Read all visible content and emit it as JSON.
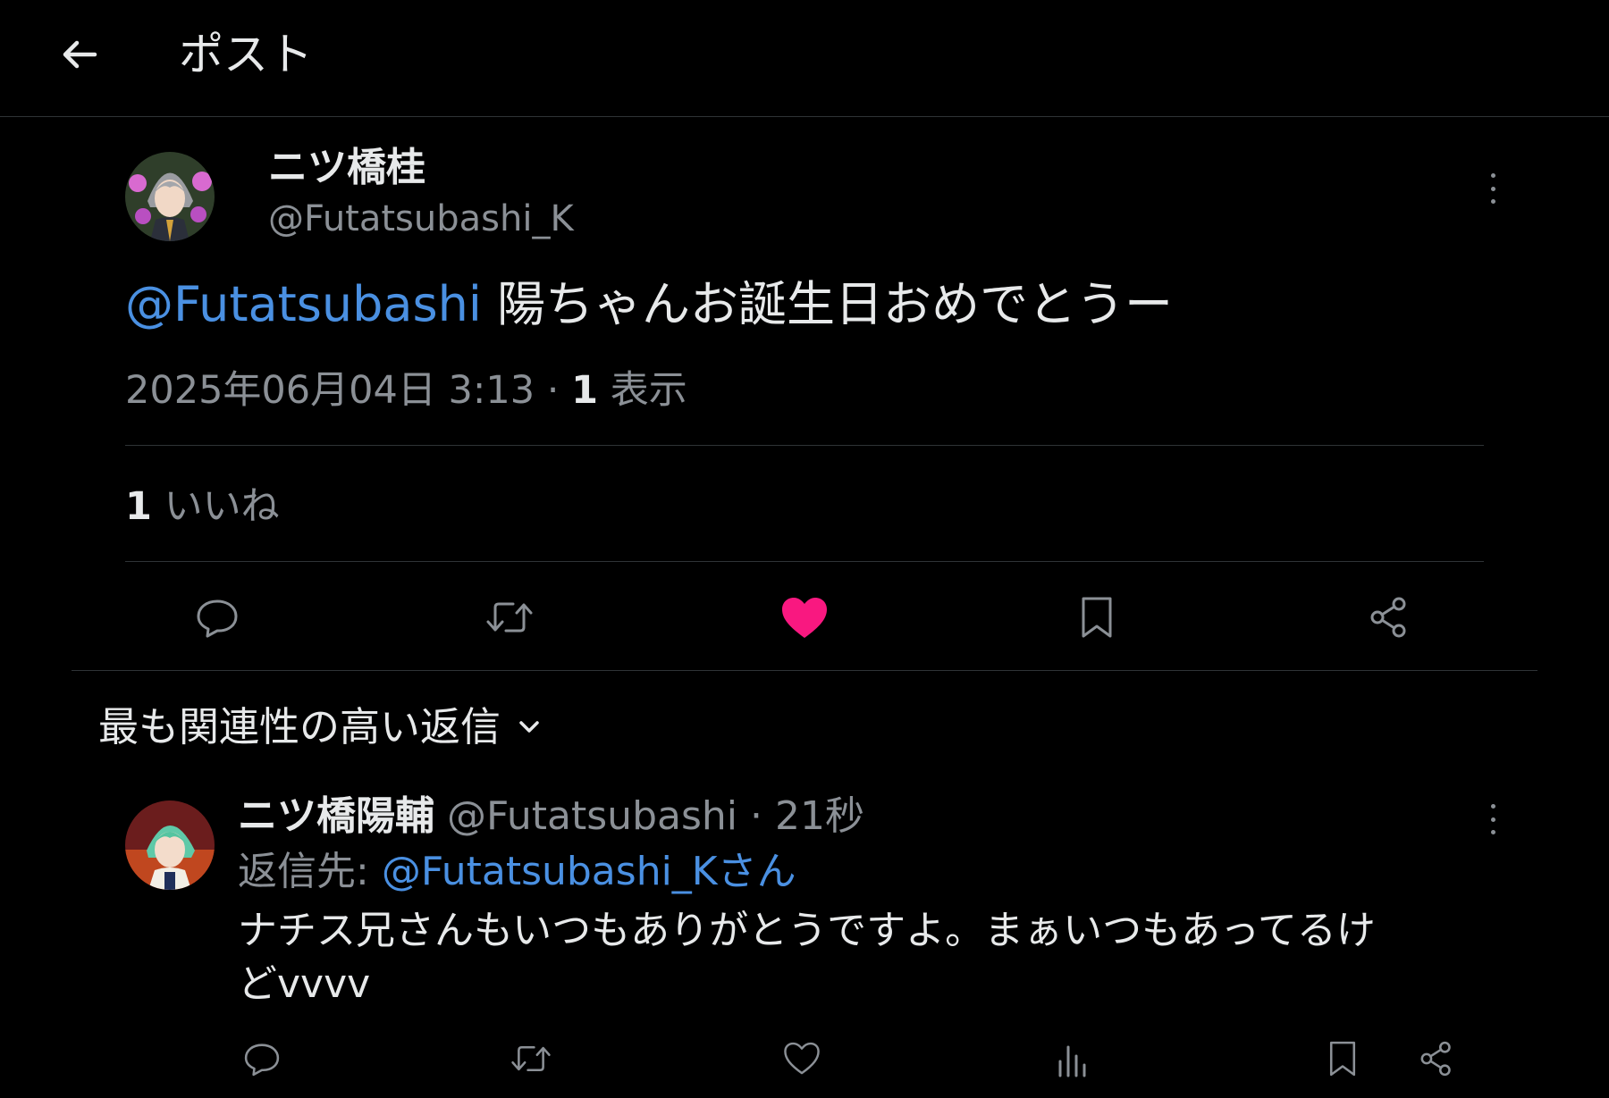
{
  "header": {
    "title": "ポスト",
    "back_icon": "arrow-left-icon"
  },
  "post": {
    "author_name": "ニツ橋桂",
    "author_handle": "@Futatsubashi_K",
    "mention": "@Futatsubashi",
    "text": " 陽ちゃんお誕生日おめでとうー",
    "timestamp": "2025年06月04日 3:13 · ",
    "view_count": "1",
    "view_label": " 表示",
    "like_count": "1",
    "like_label": " いいね",
    "actions": [
      "reply-icon",
      "retweet-icon",
      "heart-filled-icon",
      "bookmark-icon",
      "share-icon"
    ]
  },
  "replies_sort": {
    "label": "最も関連性の高い返信"
  },
  "reply": {
    "author_name": "ニツ橋陽輔",
    "author_handle": "@Futatsubashi",
    "separator": " · ",
    "time": "21秒",
    "reply_to_label": "返信先: ",
    "reply_to_handle": "@Futatsubashi_Kさん",
    "text_line1": "ナチス兄さんもいつもありがとうですよ。まぁいつもあってるけ",
    "text_line2": "どvvvv",
    "actions": [
      "reply-icon",
      "retweet-icon",
      "heart-outline-icon",
      "analytics-icon",
      "bookmark-icon",
      "share-icon"
    ]
  },
  "colors": {
    "background": "#000000",
    "text": "#e7e9ea",
    "muted": "#8b9096",
    "link": "#4a90e2",
    "like": "#f91880",
    "divider": "#2f3336"
  }
}
